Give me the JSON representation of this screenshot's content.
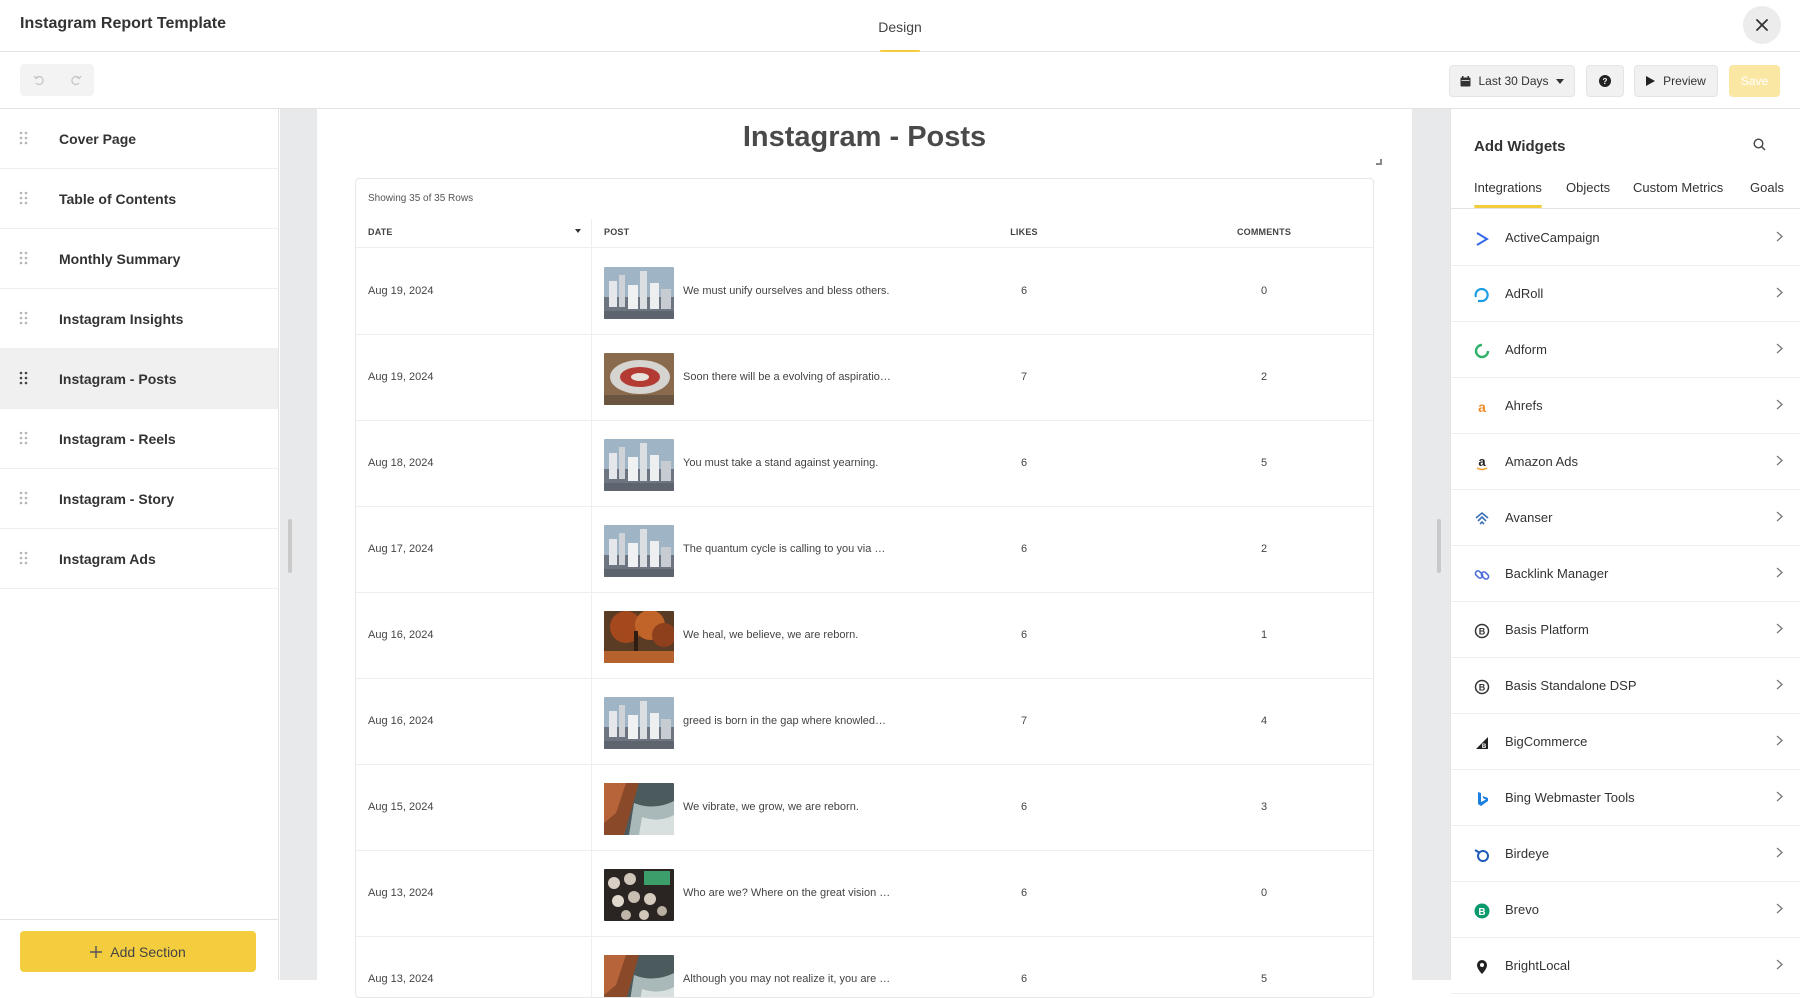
{
  "app": {
    "title": "Instagram Report Template",
    "tab": "Design"
  },
  "toolbar": {
    "date_range": "Last 30 Days",
    "preview": "Preview",
    "save": "Save"
  },
  "sidebar": {
    "items": [
      {
        "label": "Cover Page"
      },
      {
        "label": "Table of Contents"
      },
      {
        "label": "Monthly Summary"
      },
      {
        "label": "Instagram Insights"
      },
      {
        "label": "Instagram - Posts",
        "active": true
      },
      {
        "label": "Instagram - Reels"
      },
      {
        "label": "Instagram - Story"
      },
      {
        "label": "Instagram Ads"
      }
    ],
    "add_section": "Add Section"
  },
  "page": {
    "title": "Instagram - Posts",
    "table": {
      "row_count": "Showing 35 of 35 Rows",
      "headers": {
        "date": "DATE",
        "post": "POST",
        "likes": "LIKES",
        "comments": "COMMENTS"
      },
      "rows": [
        {
          "date": "Aug 19, 2024",
          "post": "We must unify ourselves and bless others.",
          "likes": "6",
          "comments": "0",
          "thumb": "city"
        },
        {
          "date": "Aug 19, 2024",
          "post": "Soon there will be a evolving of aspiratio…",
          "likes": "7",
          "comments": "2",
          "thumb": "stadium"
        },
        {
          "date": "Aug 18, 2024",
          "post": "You must take a stand against yearning.",
          "likes": "6",
          "comments": "5",
          "thumb": "city"
        },
        {
          "date": "Aug 17, 2024",
          "post": "The quantum cycle is calling to you via …",
          "likes": "6",
          "comments": "2",
          "thumb": "city"
        },
        {
          "date": "Aug 16, 2024",
          "post": "We heal, we believe, we are reborn.",
          "likes": "6",
          "comments": "1",
          "thumb": "autumn"
        },
        {
          "date": "Aug 16, 2024",
          "post": "greed is born in the gap where knowled…",
          "likes": "7",
          "comments": "4",
          "thumb": "city"
        },
        {
          "date": "Aug 15, 2024",
          "post": "We vibrate, we grow, we are reborn.",
          "likes": "6",
          "comments": "3",
          "thumb": "coast"
        },
        {
          "date": "Aug 13, 2024",
          "post": "Who are we? Where on the great vision …",
          "likes": "6",
          "comments": "0",
          "thumb": "machine"
        },
        {
          "date": "Aug 13, 2024",
          "post": "Although you may not realize it, you are …",
          "likes": "6",
          "comments": "5",
          "thumb": "coast"
        }
      ]
    }
  },
  "widgets": {
    "title": "Add Widgets",
    "tabs": [
      "Integrations",
      "Objects",
      "Custom Metrics",
      "Goals"
    ],
    "items": [
      {
        "name": "ActiveCampaign",
        "icon": "activecampaign-icon",
        "color": "#356ae6"
      },
      {
        "name": "AdRoll",
        "icon": "adroll-icon",
        "color": "#1a9ee3"
      },
      {
        "name": "Adform",
        "icon": "adform-icon",
        "color": "#2fb36b"
      },
      {
        "name": "Ahrefs",
        "icon": "ahrefs-icon",
        "color": "#f28c28"
      },
      {
        "name": "Amazon Ads",
        "icon": "amazon-icon",
        "color": "#222222"
      },
      {
        "name": "Avanser",
        "icon": "avanser-icon",
        "color": "#3a6fb7"
      },
      {
        "name": "Backlink Manager",
        "icon": "backlink-icon",
        "color": "#4b6cd8"
      },
      {
        "name": "Basis Platform",
        "icon": "basis-icon",
        "color": "#333333"
      },
      {
        "name": "Basis Standalone DSP",
        "icon": "basis-dsp-icon",
        "color": "#333333"
      },
      {
        "name": "BigCommerce",
        "icon": "bigcommerce-icon",
        "color": "#222222"
      },
      {
        "name": "Bing Webmaster Tools",
        "icon": "bing-icon",
        "color": "#1b7fe0"
      },
      {
        "name": "Birdeye",
        "icon": "birdeye-icon",
        "color": "#1e5bb8"
      },
      {
        "name": "Brevo",
        "icon": "brevo-icon",
        "color": "#0b996e"
      },
      {
        "name": "BrightLocal",
        "icon": "brightlocal-icon",
        "color": "#222222"
      }
    ]
  }
}
